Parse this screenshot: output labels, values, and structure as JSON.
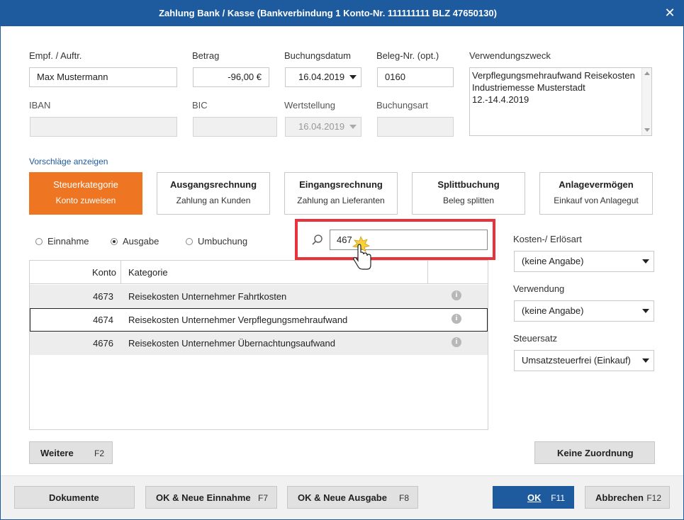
{
  "window": {
    "title": "Zahlung Bank / Kasse (Bankverbindung 1 Konto-Nr. 111111111  BLZ 47650130)",
    "close_icon": "close-icon"
  },
  "form": {
    "empf_label": "Empf. / Auftr.",
    "empf_value": "Max Mustermann",
    "betrag_label": "Betrag",
    "betrag_value": "-96,00 €",
    "buchungsdatum_label": "Buchungsdatum",
    "buchungsdatum_value": "16.04.2019",
    "beleg_label": "Beleg-Nr. (opt.)",
    "beleg_value": "0160",
    "zweck_label": "Verwendungszweck",
    "zweck_value": "Verpflegungsmehraufwand Reisekosten Industriemesse Musterstadt 12.-14.4.2019",
    "iban_label": "IBAN",
    "iban_value": "",
    "bic_label": "BIC",
    "bic_value": "",
    "wertstellung_label": "Wertstellung",
    "wertstellung_value": "16.04.2019",
    "buchungsart_label": "Buchungsart",
    "buchungsart_value": ""
  },
  "suggestions_link": "Vorschläge anzeigen",
  "categories": [
    {
      "title": "Steuerkategorie",
      "subtitle": "Konto zuweisen",
      "active": true
    },
    {
      "title": "Ausgangsrechnung",
      "subtitle": "Zahlung an Kunden",
      "active": false
    },
    {
      "title": "Eingangsrechnung",
      "subtitle": "Zahlung an Lieferanten",
      "active": false
    },
    {
      "title": "Splittbuchung",
      "subtitle": "Beleg splitten",
      "active": false
    },
    {
      "title": "Anlagevermögen",
      "subtitle": "Einkauf von Anlagegut",
      "active": false
    }
  ],
  "radios": [
    {
      "label": "Einnahme",
      "checked": false
    },
    {
      "label": "Ausgabe",
      "checked": true
    },
    {
      "label": "Umbuchung",
      "checked": false
    }
  ],
  "search": {
    "value": "467",
    "icon": "search-icon"
  },
  "table": {
    "headers": {
      "konto": "Konto",
      "kategorie": "Kategorie"
    },
    "rows": [
      {
        "konto": "4673",
        "kategorie": "Reisekosten Unternehmer Fahrtkosten",
        "selected": false
      },
      {
        "konto": "4674",
        "kategorie": "Reisekosten Unternehmer Verpflegungsmehraufwand",
        "selected": true
      },
      {
        "konto": "4676",
        "kategorie": "Reisekosten Unternehmer Übernachtungsaufwand",
        "selected": false
      }
    ]
  },
  "right_panel": {
    "kosten_label": "Kosten-/ Erlösart",
    "kosten_value": "(keine Angabe)",
    "verwendung_label": "Verwendung",
    "verwendung_value": "(keine Angabe)",
    "steuersatz_label": "Steuersatz",
    "steuersatz_value": "Umsatzsteuerfrei (Einkauf)"
  },
  "buttons": {
    "weitere": "Weitere",
    "weitere_key": "F2",
    "keine_zuordnung": "Keine Zuordnung",
    "dokumente": "Dokumente",
    "ok_neue_einnahme": "OK & Neue Einnahme",
    "ok_neue_einnahme_key": "F7",
    "ok_neue_ausgabe": "OK & Neue Ausgabe",
    "ok_neue_ausgabe_key": "F8",
    "ok": "OK",
    "ok_key": "F11",
    "abbrechen": "Abbrechen",
    "abbrechen_key": "F12"
  },
  "colors": {
    "accent_blue": "#1d5a9e",
    "accent_orange": "#ee7623",
    "highlight_red": "#e8323c"
  }
}
